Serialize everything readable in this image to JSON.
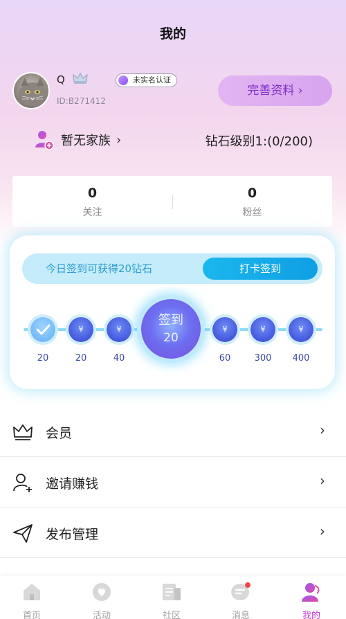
{
  "page_title": "我的",
  "profile": {
    "username": "Q",
    "verify_badge": "未实名认证",
    "user_id": "ID:B271412",
    "complete_btn": "完善资料"
  },
  "family": {
    "label": "暂无家族"
  },
  "diamond_level": "钻石级别1:(0/200)",
  "stats": [
    {
      "value": "0",
      "label": "关注"
    },
    {
      "value": "0",
      "label": "粉丝"
    }
  ],
  "signin": {
    "hint": "今日签到可获得20钻石",
    "button": "打卡签到",
    "big_line1": "签到",
    "big_line2": "20",
    "days": [
      {
        "value": "20",
        "state": "done"
      },
      {
        "value": "20",
        "symbol": "¥"
      },
      {
        "value": "40",
        "symbol": "¥"
      },
      {
        "value": "60",
        "symbol": "¥"
      },
      {
        "value": "300",
        "symbol": "¥"
      },
      {
        "value": "400",
        "symbol": "¥"
      }
    ]
  },
  "menu": [
    {
      "label": "会员",
      "icon": "crown-icon"
    },
    {
      "label": "邀请赚钱",
      "icon": "add-user-icon"
    },
    {
      "label": "发布管理",
      "icon": "send-icon"
    }
  ],
  "tabbar": [
    {
      "label": "首页",
      "icon": "home-icon",
      "active": false
    },
    {
      "label": "活动",
      "icon": "heart-chat-icon",
      "active": false
    },
    {
      "label": "社区",
      "icon": "community-icon",
      "active": false
    },
    {
      "label": "消息",
      "icon": "message-icon",
      "active": false
    },
    {
      "label": "我的",
      "icon": "profile-icon",
      "active": true
    }
  ],
  "colors": {
    "accent": "#c23ccf",
    "sign_blue": "#1bb7ee",
    "complete_text": "#7e2fc6"
  }
}
